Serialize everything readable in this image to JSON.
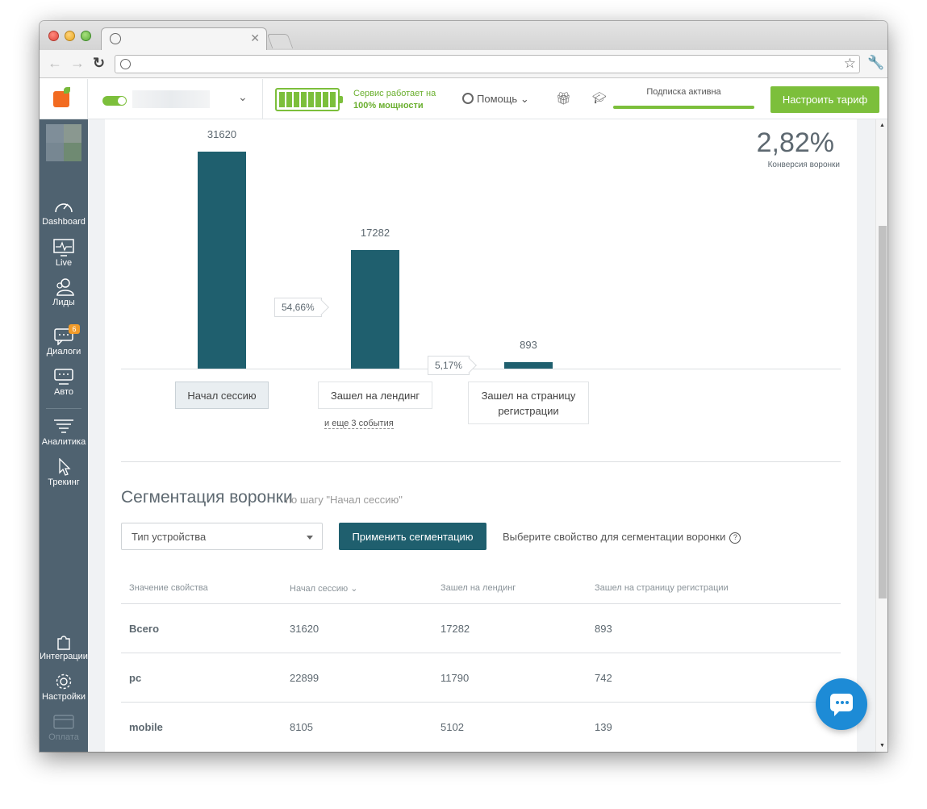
{
  "header": {
    "service_line1": "Сервис работает на",
    "service_line2": "100% мощности",
    "help_label": "Помощь",
    "subscription_label": "Подписка активна",
    "tariff_button": "Настроить тариф"
  },
  "sidebar": {
    "items": [
      {
        "label": "Dashboard",
        "icon": "speedometer-icon"
      },
      {
        "label": "Live",
        "icon": "monitor-pulse-icon"
      },
      {
        "label": "Лиды",
        "icon": "users-icon"
      },
      {
        "label": "Диалоги",
        "icon": "chat-icon",
        "badge": "6"
      },
      {
        "label": "Авто",
        "icon": "auto-message-icon"
      },
      {
        "label": "Аналитика",
        "icon": "funnel-icon"
      },
      {
        "label": "Трекинг",
        "icon": "cursor-icon"
      },
      {
        "label": "Интеграции",
        "icon": "puzzle-icon"
      },
      {
        "label": "Настройки",
        "icon": "gear-icon"
      },
      {
        "label": "Оплата",
        "icon": "card-icon"
      }
    ]
  },
  "funnel": {
    "conversion_value": "2,82%",
    "conversion_label": "Конверсия воронки",
    "steps": [
      {
        "label": "Начал сессию",
        "value": "31620"
      },
      {
        "label": "Зашел на лендинг",
        "value": "17282"
      },
      {
        "label": "Зашел на страницу регистрации",
        "value": "893"
      }
    ],
    "step_conversions": [
      "54,66%",
      "5,17%"
    ],
    "more_events": "и еще 3 события"
  },
  "segmentation": {
    "title": "Сегментация воронки",
    "subtitle": "по шагу \"Начал сессию\"",
    "select_value": "Тип устройства",
    "apply_button": "Применить сегментацию",
    "hint": "Выберите свойство для сегментации воронки",
    "hint_icon": "?",
    "columns": [
      "Значение свойства",
      "Начал сессию",
      "Зашел на лендинг",
      "Зашел на страницу регистрации"
    ],
    "rows": [
      [
        "Всего",
        "31620",
        "17282",
        "893"
      ],
      [
        "pc",
        "22899",
        "11790",
        "742"
      ],
      [
        "mobile",
        "8105",
        "5102",
        "139"
      ]
    ]
  },
  "colors": {
    "bar": "#1f5f6e",
    "accent_green": "#7cbf3b",
    "sidebar": "#4f6270",
    "chat": "#1d8bd6"
  }
}
